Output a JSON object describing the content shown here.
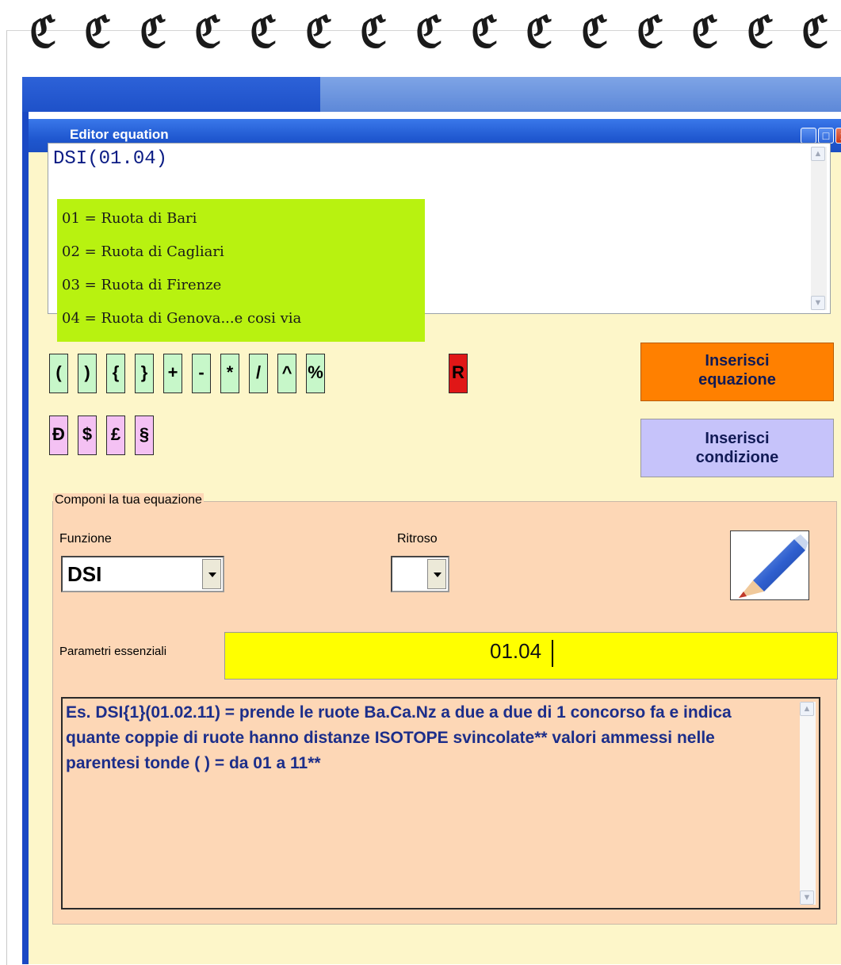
{
  "window": {
    "title": "Editor equation",
    "buttons": {
      "minimize": "_",
      "maximize": "□",
      "close": "x"
    }
  },
  "editor": {
    "equation_text": "DSI(01.04)",
    "legend": [
      "01 = Ruota di Bari",
      "02 = Ruota di Cagliari",
      "03 = Ruota di Firenze",
      "04 = Ruota di Genova...e cosi via"
    ]
  },
  "operators": {
    "row1": [
      "(",
      ")",
      "{",
      "}",
      "+",
      "-",
      "*",
      "/",
      "^",
      "%"
    ],
    "row2": [
      "Đ",
      "$",
      "£",
      "§"
    ],
    "special": "R"
  },
  "actions": {
    "insert_equation": [
      "Inserisci",
      "equazione"
    ],
    "insert_condition": [
      "Inserisci",
      "condizione"
    ]
  },
  "composer": {
    "group_label": "Componi la tua equazione",
    "function_label": "Funzione",
    "function_value": "DSI",
    "backward_label": "Ritroso",
    "backward_value": "",
    "params_label": "Parametri essenziali",
    "params_value": "01.04",
    "description": "Es. DSI{1}(01.02.11) = prende le ruote Ba.Ca.Nz a due a due di 1 concorso fa e indica quante coppie di ruote hanno distanze ISOTOPE svincolate** valori ammessi  nelle parentesi tonde ( ) = da 01 a 11**"
  },
  "colors": {
    "window_bg": "#fdf6c9",
    "titlebar": "#1f57cf",
    "legend_bg": "#b8f210",
    "composer_bg": "#fdd7b6",
    "params_bg": "#ffff00",
    "insert_equation_bg": "#ff8000",
    "insert_condition_bg": "#c6c3fa",
    "text_blue": "#1c2e8a"
  },
  "icons": {
    "spiral": "spiral-binding-icon",
    "pencil": "pencil-icon"
  }
}
